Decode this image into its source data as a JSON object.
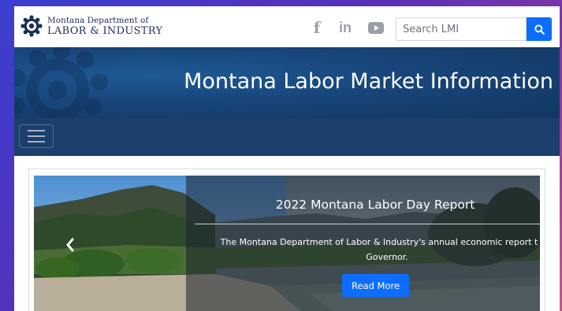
{
  "header": {
    "logo": {
      "line1": "Montana Department of",
      "line2": "LABOR & INDUSTRY"
    },
    "social": [
      {
        "icon": "facebook-icon",
        "glyph": "f"
      },
      {
        "icon": "linkedin-icon",
        "glyph": "in"
      },
      {
        "icon": "youtube-icon"
      }
    ],
    "search": {
      "placeholder": "Search LMI",
      "icon": "search-icon"
    }
  },
  "banner": {
    "title": "Montana Labor Market Information"
  },
  "nav": {
    "toggle_icon": "hamburger-menu-icon"
  },
  "carousel": {
    "slide": {
      "title": "2022 Montana Labor Day Report",
      "text_line1": "The Montana Department of Labor & Industry's annual economic report t",
      "text_line2": "Governor.",
      "button": "Read More"
    },
    "prev_icon": "chevron-left-icon"
  },
  "colors": {
    "brand_navy": "#1c3f6b",
    "banner_blue": "#18457a",
    "accent_blue": "#0d6efd",
    "icon_gray": "#9aa0a6",
    "logo_text": "#1c2e5a"
  }
}
